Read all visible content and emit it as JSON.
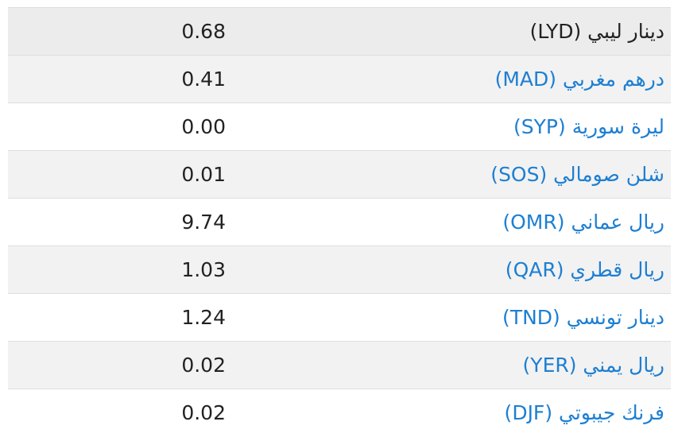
{
  "colors": {
    "link": "#1d7fd2",
    "text": "#222222",
    "row_highlight": "#ececec",
    "row_alt": "#f2f2f2",
    "border": "#dedede"
  },
  "rates": [
    {
      "name": "دينار ليبي (LYD)",
      "value": "0.68",
      "linked": false
    },
    {
      "name": "درهم مغربي (MAD)",
      "value": "0.41",
      "linked": true
    },
    {
      "name": "ليرة سورية (SYP)",
      "value": "0.00",
      "linked": true
    },
    {
      "name": "شلن صومالي (SOS)",
      "value": "0.01",
      "linked": true
    },
    {
      "name": "ريال عماني (OMR)",
      "value": "9.74",
      "linked": true
    },
    {
      "name": "ريال قطري (QAR)",
      "value": "1.03",
      "linked": true
    },
    {
      "name": "دينار تونسي (TND)",
      "value": "1.24",
      "linked": true
    },
    {
      "name": "ريال يمني (YER)",
      "value": "0.02",
      "linked": true
    },
    {
      "name": "فرنك جيبوتي (DJF)",
      "value": "0.02",
      "linked": true
    }
  ]
}
